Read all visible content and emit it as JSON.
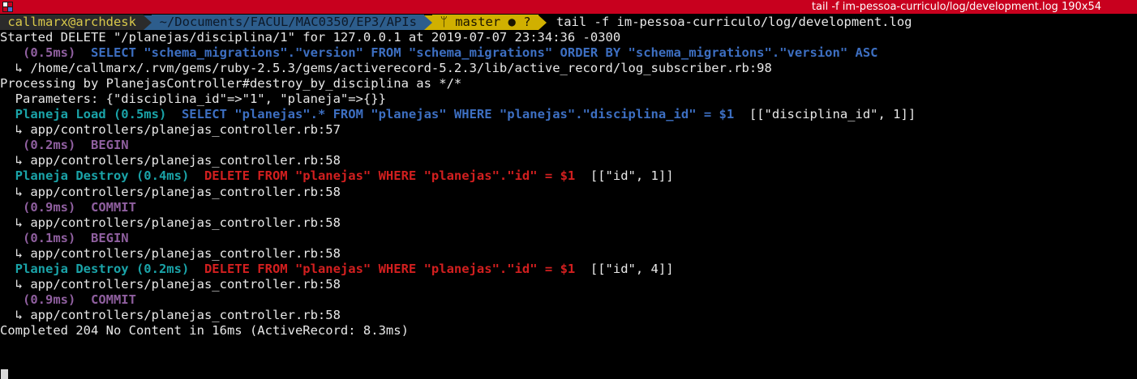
{
  "window": {
    "title": "tail -f im-pessoa-curriculo/log/development.log 190x54"
  },
  "prompt": {
    "user_host": " callmarx@archdesk ",
    "path": " ~/Documents/FACUL/MAC0350/EP3/APIs ",
    "git": " ᛘ master ● ? ",
    "command": "tail -f im-pessoa-curriculo/log/development.log"
  },
  "log": {
    "l1": "Started DELETE \"/planejas/disciplina/1\" for 127.0.0.1 at 2019-07-07 23:34:36 -0300",
    "l2_time": "   (0.5ms)  ",
    "l2_sql": "SELECT \"schema_migrations\".\"version\" FROM \"schema_migrations\" ORDER BY \"schema_migrations\".\"version\" ASC",
    "l3": "  ↳ /home/callmarx/.rvm/gems/ruby-2.5.3/gems/activerecord-5.2.3/lib/active_record/log_subscriber.rb:98",
    "l4": "Processing by PlanejasController#destroy_by_disciplina as */*",
    "l5": "  Parameters: {\"disciplina_id\"=>\"1\", \"planeja\"=>{}}",
    "l6_label": "  Planeja Load (0.5ms)  ",
    "l6_sql": "SELECT \"planejas\".* FROM \"planejas\" WHERE \"planejas\".\"disciplina_id\" = $1",
    "l6_binds": "  [[\"disciplina_id\", 1]]",
    "l7": "  ↳ app/controllers/planejas_controller.rb:57",
    "l8": "   (0.2ms)  BEGIN",
    "l9": "  ↳ app/controllers/planejas_controller.rb:58",
    "l10_label": "  Planeja Destroy (0.4ms)  ",
    "l10_sql": "DELETE FROM \"planejas\" WHERE \"planejas\".\"id\" = $1",
    "l10_binds": "  [[\"id\", 1]]",
    "l11": "  ↳ app/controllers/planejas_controller.rb:58",
    "l12": "   (0.9ms)  COMMIT",
    "l13": "  ↳ app/controllers/planejas_controller.rb:58",
    "l14": "   (0.1ms)  BEGIN",
    "l15": "  ↳ app/controllers/planejas_controller.rb:58",
    "l16_label": "  Planeja Destroy (0.2ms)  ",
    "l16_sql": "DELETE FROM \"planejas\" WHERE \"planejas\".\"id\" = $1",
    "l16_binds": "  [[\"id\", 4]]",
    "l17": "  ↳ app/controllers/planejas_controller.rb:58",
    "l18": "   (0.9ms)  COMMIT",
    "l19": "  ↳ app/controllers/planejas_controller.rb:58",
    "l20": "Completed 204 No Content in 16ms (ActiveRecord: 8.3ms)"
  },
  "colors": {
    "titlebar": "#c8001e",
    "background": "#000000",
    "text": "#e8e8e8",
    "sql_select": "#3d6fc2",
    "sql_delete": "#d21f1f",
    "model_label": "#1aa3a8",
    "transaction": "#8f5f9f"
  },
  "icons": {
    "window_menu": "window-menu-icon",
    "git_branch": "git-branch-icon",
    "cursor": "terminal-cursor"
  }
}
